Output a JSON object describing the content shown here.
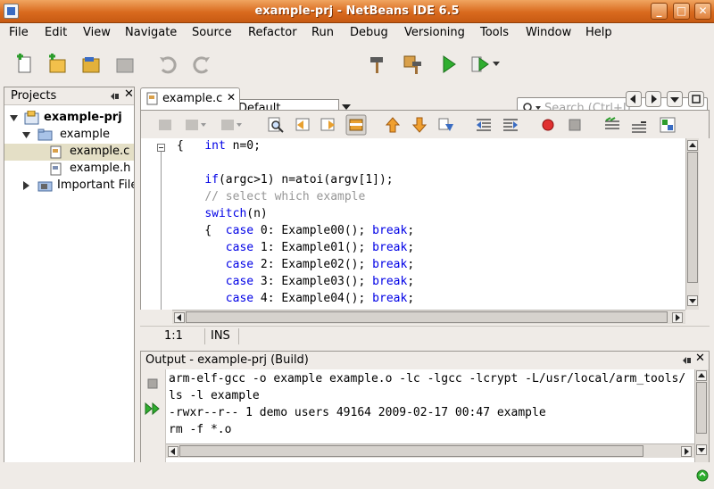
{
  "window": {
    "title": "example-prj - NetBeans IDE 6.5"
  },
  "menu": [
    "File",
    "Edit",
    "View",
    "Navigate",
    "Source",
    "Refactor",
    "Run",
    "Debug",
    "Versioning",
    "Tools",
    "Window",
    "Help"
  ],
  "toolbar": {
    "config_value": "Default",
    "search_placeholder": "Search (Ctrl+I)"
  },
  "projects": {
    "title": "Projects",
    "tree": [
      {
        "label": "example-prj"
      },
      {
        "label": "example"
      },
      {
        "label": "example.c"
      },
      {
        "label": "example.h"
      },
      {
        "label": "Important Files"
      }
    ]
  },
  "editor": {
    "tab_label": "example.c",
    "code": [
      [
        {
          "t": "{   ",
          "c": ""
        },
        {
          "t": "int",
          "c": "kw"
        },
        {
          "t": " n=0;",
          "c": ""
        }
      ],
      [],
      [
        {
          "t": "    ",
          "c": ""
        },
        {
          "t": "if",
          "c": "kw"
        },
        {
          "t": "(argc>1) n=atoi(argv[1]);",
          "c": ""
        }
      ],
      [
        {
          "t": "    ",
          "c": ""
        },
        {
          "t": "// select which example",
          "c": "cm"
        }
      ],
      [
        {
          "t": "    ",
          "c": ""
        },
        {
          "t": "switch",
          "c": "kw"
        },
        {
          "t": "(n)",
          "c": ""
        }
      ],
      [
        {
          "t": "    {  ",
          "c": ""
        },
        {
          "t": "case",
          "c": "kw"
        },
        {
          "t": " 0: Example00(); ",
          "c": ""
        },
        {
          "t": "break",
          "c": "kw"
        },
        {
          "t": ";",
          "c": ""
        }
      ],
      [
        {
          "t": "       ",
          "c": ""
        },
        {
          "t": "case",
          "c": "kw"
        },
        {
          "t": " 1: Example01(); ",
          "c": ""
        },
        {
          "t": "break",
          "c": "kw"
        },
        {
          "t": ";",
          "c": ""
        }
      ],
      [
        {
          "t": "       ",
          "c": ""
        },
        {
          "t": "case",
          "c": "kw"
        },
        {
          "t": " 2: Example02(); ",
          "c": ""
        },
        {
          "t": "break",
          "c": "kw"
        },
        {
          "t": ";",
          "c": ""
        }
      ],
      [
        {
          "t": "       ",
          "c": ""
        },
        {
          "t": "case",
          "c": "kw"
        },
        {
          "t": " 3: Example03(); ",
          "c": ""
        },
        {
          "t": "break",
          "c": "kw"
        },
        {
          "t": ";",
          "c": ""
        }
      ],
      [
        {
          "t": "       ",
          "c": ""
        },
        {
          "t": "case",
          "c": "kw"
        },
        {
          "t": " 4: Example04(); ",
          "c": ""
        },
        {
          "t": "break",
          "c": "kw"
        },
        {
          "t": ";",
          "c": ""
        }
      ]
    ],
    "status_pos": "1:1",
    "status_mode": "INS"
  },
  "output": {
    "title": "Output - example-prj (Build)",
    "lines": [
      "arm-elf-gcc -o example example.o -lc -lgcc -lcrypt -L/usr/local/arm_tools/",
      "ls -l example",
      "-rwxr--r-- 1 demo users 49164 2009-02-17 00:47 example",
      "rm -f *.o"
    ]
  }
}
